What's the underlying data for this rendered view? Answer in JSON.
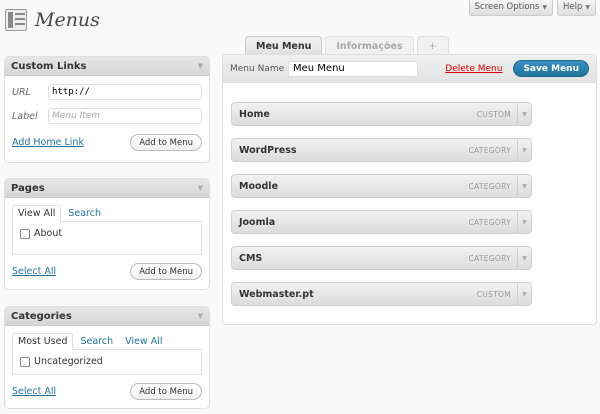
{
  "screen_meta": {
    "screen_options": "Screen Options",
    "help": "Help"
  },
  "page": {
    "title": "Menus"
  },
  "custom_links": {
    "title": "Custom Links",
    "url_label": "URL",
    "url_value": "http://",
    "label_label": "Label",
    "label_placeholder": "Menu Item",
    "home_link": "Add Home Link",
    "add_button": "Add to Menu"
  },
  "pages": {
    "title": "Pages",
    "tabs": [
      "View All",
      "Search"
    ],
    "items": [
      "About"
    ],
    "select_all": "Select All",
    "add_button": "Add to Menu"
  },
  "categories": {
    "title": "Categories",
    "tabs": [
      "Most Used",
      "Search",
      "View All"
    ],
    "items": [
      "Uncategorized"
    ],
    "select_all": "Select All",
    "add_button": "Add to Menu"
  },
  "menu_tabs": [
    "Meu Menu",
    "Informações",
    "+"
  ],
  "editor": {
    "name_label": "Menu Name",
    "name_value": "Meu Menu",
    "delete_label": "Delete Menu",
    "save_label": "Save Menu",
    "items": [
      {
        "name": "Home",
        "type": "CUSTOM"
      },
      {
        "name": "WordPress",
        "type": "CATEGORY"
      },
      {
        "name": "Moodle",
        "type": "CATEGORY"
      },
      {
        "name": "Joomla",
        "type": "CATEGORY"
      },
      {
        "name": "CMS",
        "type": "CATEGORY"
      },
      {
        "name": "Webmaster.pt",
        "type": "CUSTOM"
      }
    ]
  }
}
